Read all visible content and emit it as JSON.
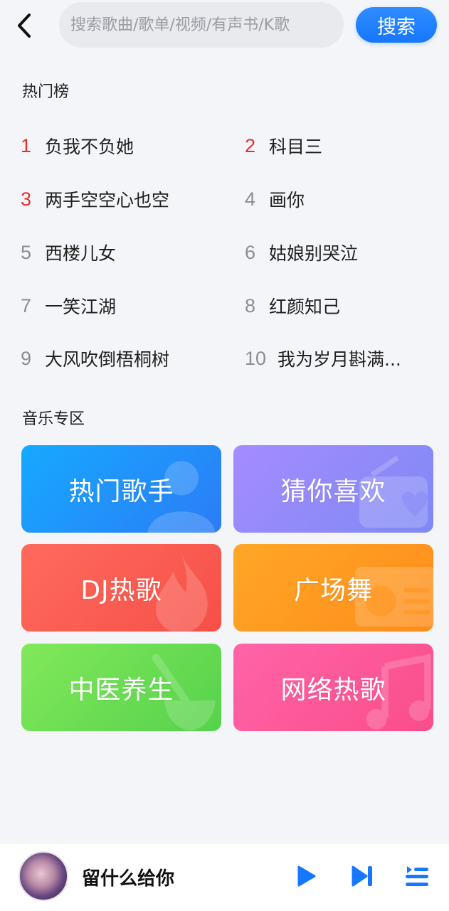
{
  "search": {
    "placeholder": "搜索歌曲/歌单/视频/有声书/K歌",
    "button_label": "搜索"
  },
  "hot": {
    "title": "热门榜",
    "items": [
      {
        "rank": "1",
        "title": "负我不负她"
      },
      {
        "rank": "2",
        "title": "科目三"
      },
      {
        "rank": "3",
        "title": "两手空空心也空"
      },
      {
        "rank": "4",
        "title": "画你"
      },
      {
        "rank": "5",
        "title": "西楼儿女"
      },
      {
        "rank": "6",
        "title": "姑娘别哭泣"
      },
      {
        "rank": "7",
        "title": "一笑江湖"
      },
      {
        "rank": "8",
        "title": "红颜知己"
      },
      {
        "rank": "9",
        "title": "大风吹倒梧桐树"
      },
      {
        "rank": "10",
        "title": "我为岁月斟满..."
      }
    ]
  },
  "zone": {
    "title": "音乐专区",
    "cards": [
      {
        "label": "热门歌手",
        "icon": "person-icon"
      },
      {
        "label": "猜你喜欢",
        "icon": "radio-heart-icon"
      },
      {
        "label": "DJ热歌",
        "icon": "flame-icon"
      },
      {
        "label": "广场舞",
        "icon": "boombox-icon"
      },
      {
        "label": "中医养生",
        "icon": "mortar-icon"
      },
      {
        "label": "网络热歌",
        "icon": "music-note-icon"
      }
    ]
  },
  "player": {
    "title": "留什么给你",
    "accent": "#1677ff"
  },
  "colors": {
    "rank_top": "#e0302f",
    "rank_other": "#8b8d92"
  }
}
